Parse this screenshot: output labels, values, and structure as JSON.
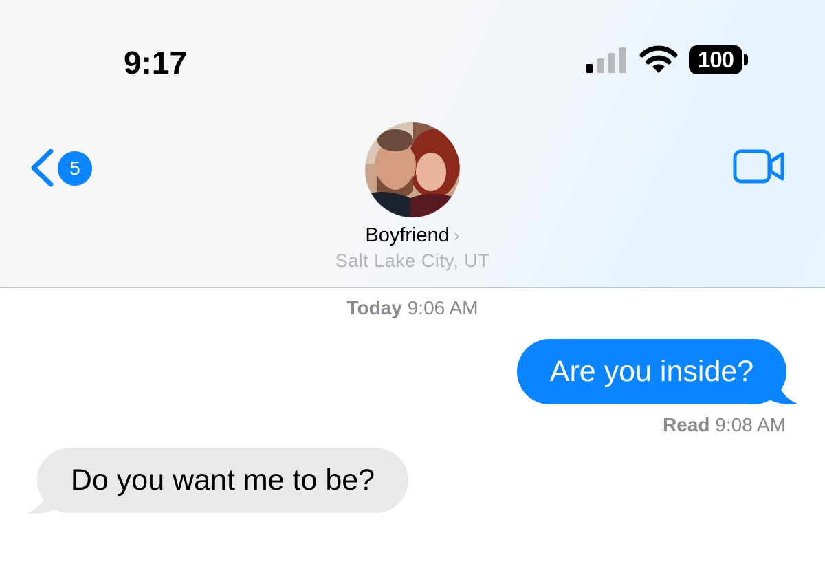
{
  "status_bar": {
    "time": "9:17",
    "battery": "100",
    "signal_icon": "cellular-signal-icon",
    "wifi_icon": "wifi-icon"
  },
  "nav": {
    "back_badge": "5",
    "back_icon": "chevron-left-icon",
    "video_icon": "video-camera-icon"
  },
  "contact": {
    "name": "Boyfriend",
    "chevron": "›",
    "location": "Salt Lake City, UT"
  },
  "conversation": {
    "timestamp_day": "Today",
    "timestamp_time": "9:06 AM",
    "messages": [
      {
        "direction": "outgoing",
        "text": "Are you inside?"
      },
      {
        "direction": "incoming",
        "text": "Do you want me to be?"
      }
    ],
    "read_label": "Read",
    "read_time": "9:08 AM"
  },
  "colors": {
    "accent": "#0a84ff",
    "incoming_bubble": "#e9e9eb",
    "secondary_text": "#8a8a8e"
  }
}
